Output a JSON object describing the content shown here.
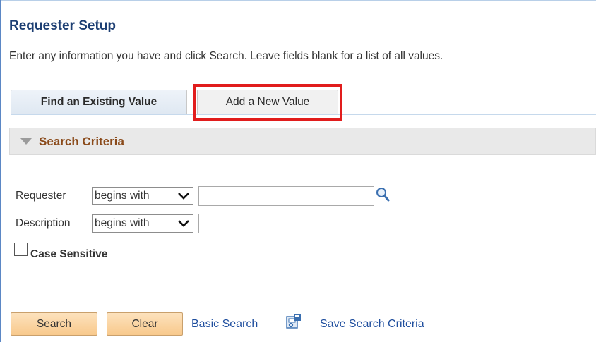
{
  "page": {
    "title": "Requester Setup",
    "instructions": "Enter any information you have and click Search. Leave fields blank for a list of all values."
  },
  "tabs": {
    "find_label": "Find an Existing Value",
    "add_label": "Add a New Value"
  },
  "criteria": {
    "header": "Search Criteria"
  },
  "fields": [
    {
      "label": "Requester",
      "operator": "begins with",
      "value": ""
    },
    {
      "label": "Description",
      "operator": "begins with",
      "value": ""
    }
  ],
  "case_sensitive": {
    "label": "Case Sensitive",
    "checked": false
  },
  "actions": {
    "search_label": "Search",
    "clear_label": "Clear",
    "basic_search_label": "Basic Search",
    "save_criteria_label": "Save Search Criteria"
  },
  "icons": {
    "lookup": "magnifier-icon",
    "save": "save-search-icon",
    "collapse": "triangle-down-icon",
    "select_chevron": "chevron-down-icon"
  },
  "colors": {
    "title": "#1d3f73",
    "criteria_header": "#8a4a1a",
    "button_bg": "#f8c98c",
    "link": "#1f4e9e",
    "highlight": "#e11d1d"
  }
}
